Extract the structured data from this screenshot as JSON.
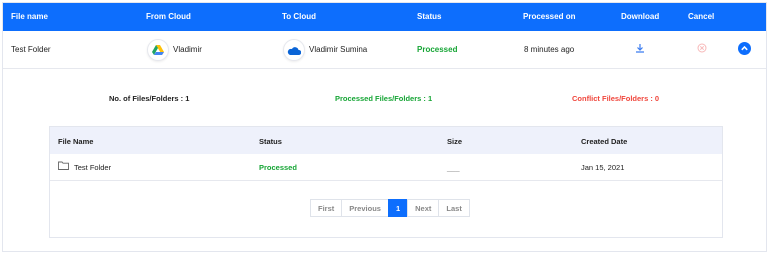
{
  "columns": {
    "file_name": "File name",
    "from_cloud": "From Cloud",
    "to_cloud": "To Cloud",
    "status": "Status",
    "processed_on": "Processed on",
    "download": "Download",
    "cancel": "Cancel"
  },
  "row": {
    "file_name": "Test Folder",
    "from_cloud": "Vladimir",
    "to_cloud": "Vladimir Sumina",
    "status": "Processed",
    "processed_on": "8 minutes ago"
  },
  "summary": {
    "files": "No. of Files/Folders : 1",
    "processed": "Processed Files/Folders : 1",
    "conflict": "Conflict Files/Folders : 0"
  },
  "detail": {
    "headers": {
      "file_name": "File Name",
      "status": "Status",
      "size": "Size",
      "created": "Created Date"
    },
    "rows": [
      {
        "file_name": "Test Folder",
        "status": "Processed",
        "size": "___",
        "created": "Jan 15, 2021"
      }
    ]
  },
  "pagination": {
    "first": "First",
    "previous": "Previous",
    "current": "1",
    "next": "Next",
    "last": "Last"
  },
  "colors": {
    "accent": "#0d6efd",
    "processed": "#16a535",
    "conflict": "#f0463c",
    "header_bg": "#eef1fb"
  },
  "icons": {
    "from_cloud": "google-drive-icon",
    "to_cloud": "onedrive-icon",
    "download": "download-icon",
    "cancel": "cancel-icon",
    "collapse": "chevron-up-icon",
    "folder": "folder-icon"
  }
}
